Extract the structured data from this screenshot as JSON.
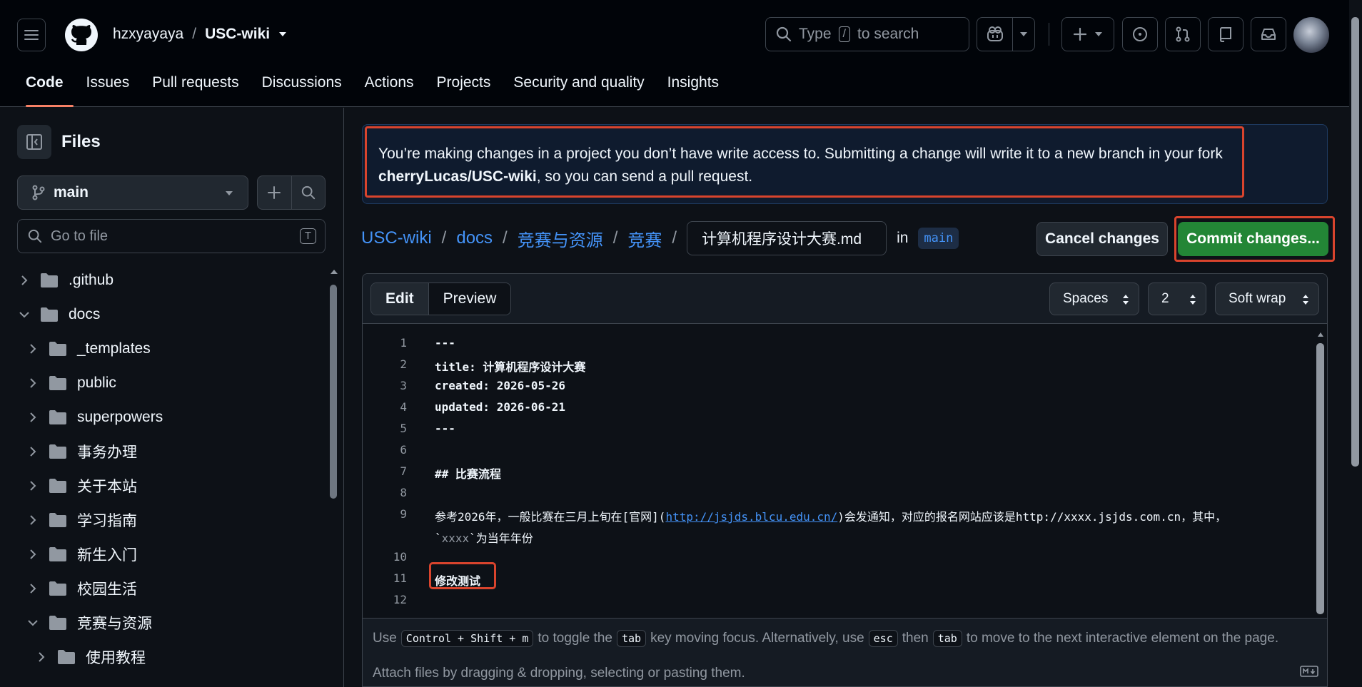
{
  "header": {
    "owner": "hzxyayaya",
    "slash": "/",
    "repo": "USC-wiki",
    "search_type": "Type",
    "search_key": "/",
    "search_rest": "to search"
  },
  "nav": {
    "tabs": [
      {
        "label": "Code",
        "active": true
      },
      {
        "label": "Issues"
      },
      {
        "label": "Pull requests"
      },
      {
        "label": "Discussions"
      },
      {
        "label": "Actions"
      },
      {
        "label": "Projects"
      },
      {
        "label": "Security and quality"
      },
      {
        "label": "Insights"
      }
    ]
  },
  "sidebar": {
    "title": "Files",
    "branch": "main",
    "go_to_file_placeholder": "Go to file",
    "go_to_file_key": "T",
    "tree": [
      {
        "label": ".github",
        "depth": 0,
        "expanded": false
      },
      {
        "label": "docs",
        "depth": 0,
        "expanded": true
      },
      {
        "label": "_templates",
        "depth": 1,
        "expanded": false
      },
      {
        "label": "public",
        "depth": 1,
        "expanded": false
      },
      {
        "label": "superpowers",
        "depth": 1,
        "expanded": false
      },
      {
        "label": "事务办理",
        "depth": 1,
        "expanded": false
      },
      {
        "label": "关于本站",
        "depth": 1,
        "expanded": false
      },
      {
        "label": "学习指南",
        "depth": 1,
        "expanded": false
      },
      {
        "label": "新生入门",
        "depth": 1,
        "expanded": false
      },
      {
        "label": "校园生活",
        "depth": 1,
        "expanded": false
      },
      {
        "label": "竞赛与资源",
        "depth": 1,
        "expanded": true
      },
      {
        "label": "使用教程",
        "depth": 2,
        "expanded": false
      }
    ]
  },
  "banner": {
    "text_before": "You’re making changes in a project you don’t have write access to. Submitting a change will write it to a new branch in your fork ",
    "fork": "cherryLucas/USC-wiki",
    "text_after": ", so you can send a pull request."
  },
  "path": {
    "repo": "USC-wiki",
    "sep": "/",
    "docs": "docs",
    "folder1": "竞赛与资源",
    "folder2": "竞赛",
    "filename": "计算机程序设计大赛.md",
    "in": "in",
    "branch": "main"
  },
  "actions": {
    "cancel": "Cancel changes",
    "commit": "Commit changes..."
  },
  "editor": {
    "tab_edit": "Edit",
    "tab_preview": "Preview",
    "indent_mode": "Spaces",
    "indent_size": "2",
    "wrap_mode": "Soft wrap",
    "lines": [
      {
        "n": "1",
        "text": "---"
      },
      {
        "n": "2",
        "text": "title: 计算机程序设计大赛"
      },
      {
        "n": "3",
        "text": "created: 2026-05-26"
      },
      {
        "n": "4",
        "text": "updated: 2026-06-21"
      },
      {
        "n": "5",
        "text": "---"
      },
      {
        "n": "6",
        "text": ""
      },
      {
        "n": "7",
        "text": "## 比赛流程"
      },
      {
        "n": "8",
        "text": ""
      },
      {
        "n": "9",
        "text_a": "参考2026年，一般比赛在三月上旬在[官网](",
        "link": "http://jsjds.blcu.edu.cn/",
        "text_b": ")会发通知，对应的报名网站应该是http://xxxx.jsjds.com.cn，其中，",
        "cont_a": "`",
        "cont_code": "xxxx",
        "cont_b": "`为当年年份"
      },
      {
        "n": "10",
        "text": ""
      },
      {
        "n": "11",
        "text": "修改测试"
      },
      {
        "n": "12",
        "text": ""
      }
    ],
    "hint": {
      "use": "Use",
      "combo": "Control + Shift + m",
      "toggle": "to toggle the",
      "tab": "tab",
      "moving": "key moving focus. Alternatively, use",
      "esc": "esc",
      "then": "then",
      "tab2": "tab",
      "next": "to move to the next interactive element on the page."
    },
    "attach": "Attach files by dragging & dropping, selecting or pasting them."
  },
  "colors": {
    "accent_link": "#4493f8",
    "commit_green": "#238636",
    "highlight_red": "#d9442d",
    "tab_underline": "#f78166"
  }
}
